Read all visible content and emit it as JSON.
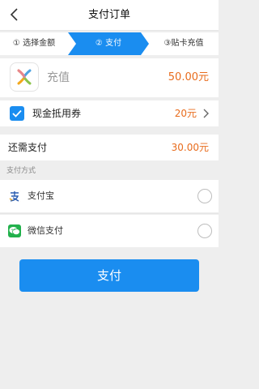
{
  "header": {
    "title": "支付订单"
  },
  "steps": [
    "① 选择金额",
    "② 支付",
    "③贴卡充值"
  ],
  "product": {
    "name": "充值",
    "price": "50.00元"
  },
  "coupon": {
    "label": "现金抵用券",
    "value": "20元",
    "checked": true
  },
  "due": {
    "label": "还需支付",
    "value": "30.00元"
  },
  "payment_methods": {
    "title": "支付方式",
    "items": [
      {
        "label": "支付宝",
        "icon": "alipay-icon",
        "selected": false
      },
      {
        "label": "微信支付",
        "icon": "wechat-pay-icon",
        "selected": false
      }
    ]
  },
  "pay_button": {
    "label": "支付"
  },
  "colors": {
    "accent": "#1a8df0",
    "price": "#e86c1d"
  }
}
